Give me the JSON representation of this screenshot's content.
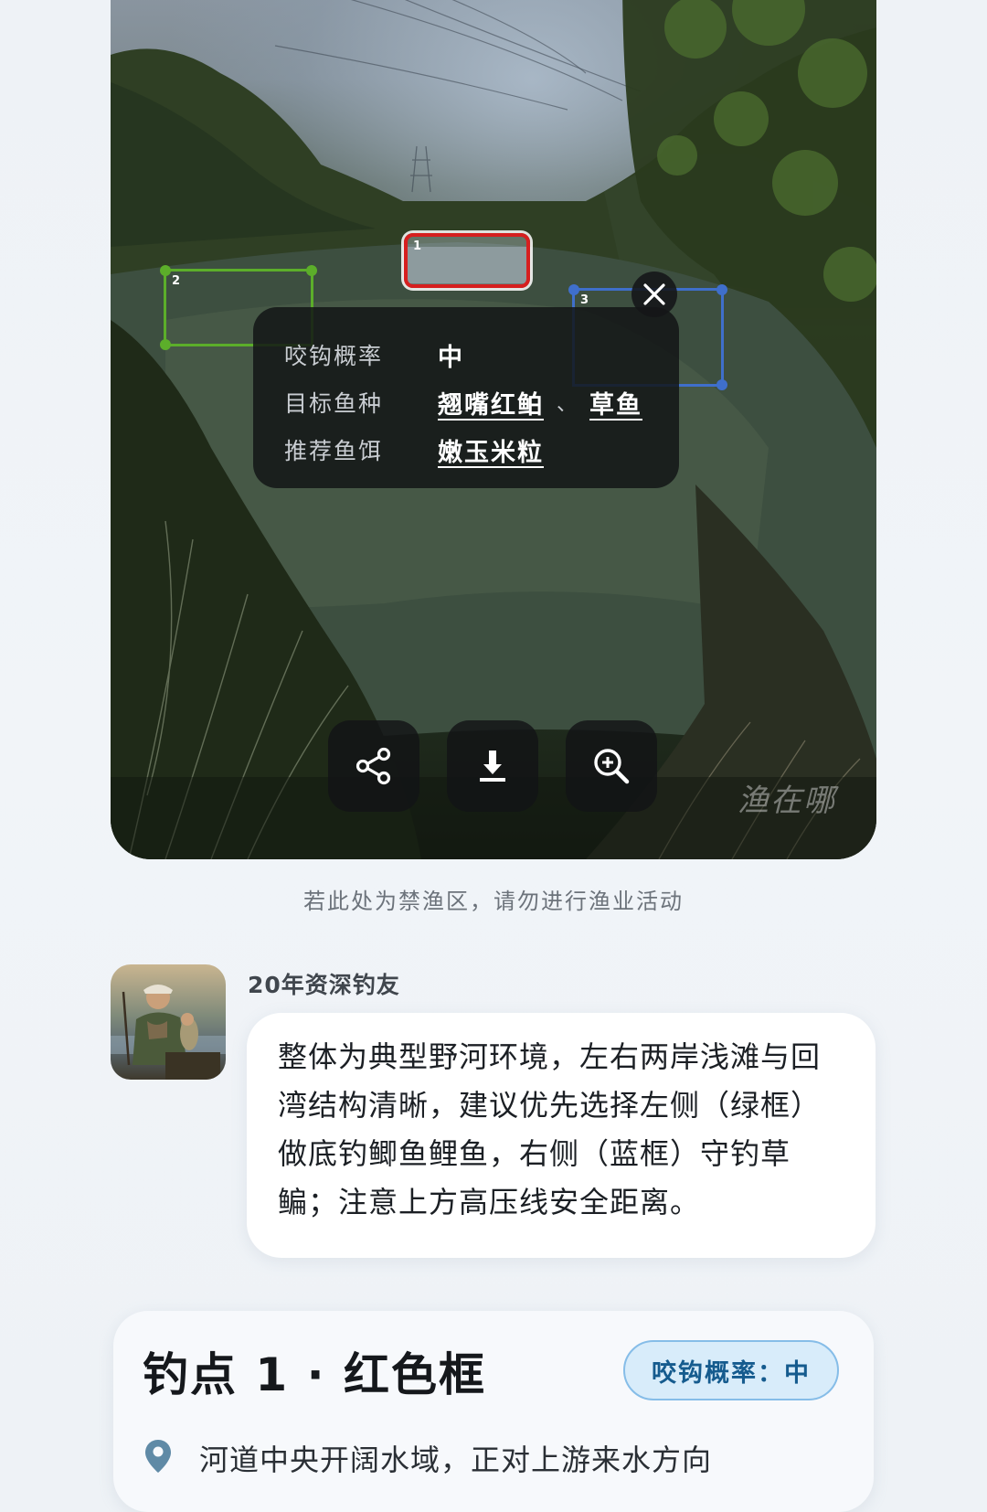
{
  "photo": {
    "detections": [
      {
        "id": "1",
        "color": "#d61f1f"
      },
      {
        "id": "2",
        "color": "#5cae2a"
      },
      {
        "id": "3",
        "color": "#3f6fcb"
      }
    ],
    "watermark": "渔在哪"
  },
  "info_popup": {
    "bite_label": "咬钩概率",
    "bite_value": "中",
    "species_label": "目标鱼种",
    "species": [
      "翘嘴红鲌",
      "草鱼"
    ],
    "separator": "、",
    "bait_label": "推荐鱼饵",
    "bait": "嫩玉米粒",
    "close_icon": "close-icon"
  },
  "actions": {
    "share_icon": "share-icon",
    "download_icon": "download-icon",
    "zoom_icon": "zoom-in-icon"
  },
  "notice": "若此处为禁渔区，请勿进行渔业活动",
  "expert": {
    "name": "20年资深钓友",
    "comment_lines": [
      "整体为典型野河环境，左右两岸浅滩与回",
      "湾结构清晰，建议优先选择左侧（绿框）",
      "做底钓鲫鱼鲤鱼，右侧（蓝框）守钓草",
      "鳊；注意上方高压线安全距离。"
    ]
  },
  "spot": {
    "title": "钓点 1 · 红色框",
    "badge": "咬钩概率：中",
    "location_icon": "location-pin-icon",
    "location": "河道中央开阔水域，正对上游来水方向"
  },
  "colors": {
    "accent_badge_bg": "#d8ecfa",
    "accent_badge_text": "#155b8e",
    "location_icon": "#5f8aa6"
  }
}
